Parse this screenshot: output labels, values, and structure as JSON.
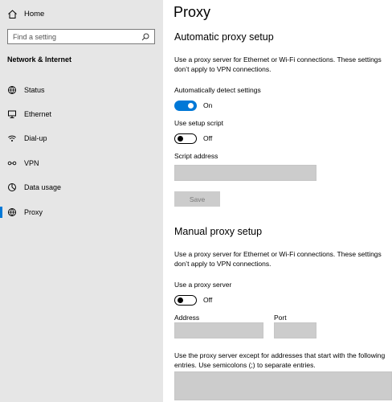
{
  "sidebar": {
    "home_label": "Home",
    "search_placeholder": "Find a setting",
    "section_title": "Network & Internet",
    "items": [
      {
        "label": "Status",
        "icon": "globe-status-icon"
      },
      {
        "label": "Ethernet",
        "icon": "ethernet-icon"
      },
      {
        "label": "Dial-up",
        "icon": "dial-up-icon"
      },
      {
        "label": "VPN",
        "icon": "vpn-icon"
      },
      {
        "label": "Data usage",
        "icon": "data-usage-icon"
      },
      {
        "label": "Proxy",
        "icon": "globe-icon",
        "active": true
      }
    ]
  },
  "main": {
    "title": "Proxy",
    "automatic": {
      "heading": "Automatic proxy setup",
      "description": "Use a proxy server for Ethernet or Wi-Fi connections. These settings don’t apply to VPN connections.",
      "detect_label": "Automatically detect settings",
      "detect_state": "On",
      "script_label": "Use setup script",
      "script_state": "Off",
      "address_label": "Script address",
      "address_value": "",
      "save_label": "Save"
    },
    "manual": {
      "heading": "Manual proxy setup",
      "description": "Use a proxy server for Ethernet or Wi-Fi connections. These settings don’t apply to VPN connections.",
      "use_proxy_label": "Use a proxy server",
      "use_proxy_state": "Off",
      "address_label": "Address",
      "address_value": "",
      "port_label": "Port",
      "port_value": "",
      "exceptions_description": "Use the proxy server except for addresses that start with the following entries. Use semicolons (;) to separate entries.",
      "exceptions_value": ""
    }
  },
  "colors": {
    "accent": "#0078d7",
    "sidebar_bg": "#e6e6e6",
    "field_bg": "#cccccc"
  }
}
